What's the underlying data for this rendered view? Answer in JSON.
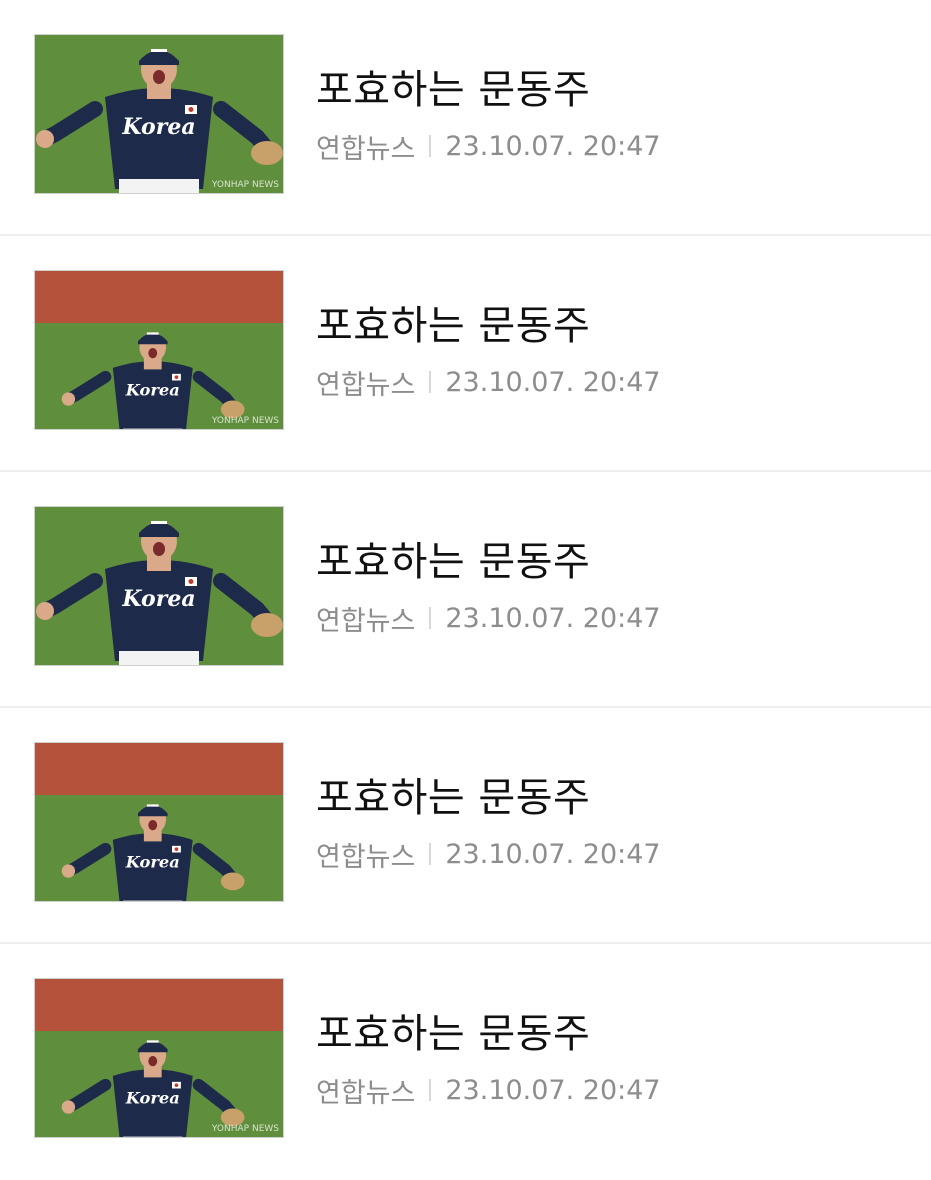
{
  "news_list": {
    "items": [
      {
        "thumbnail_alt": "",
        "title": "포효하는 문동주",
        "source": "연합뉴스",
        "datetime": "23.10.07. 20:47",
        "watermark": "YONHAP NEWS",
        "jersey_text": "Korea",
        "photo_variant": "closeup"
      },
      {
        "thumbnail_alt": "",
        "title": "포효하는 문동주",
        "source": "연합뉴스",
        "datetime": "23.10.07. 20:47",
        "watermark": "YONHAP NEWS",
        "jersey_text": "Korea",
        "photo_variant": "wide"
      },
      {
        "thumbnail_alt": "",
        "title": "포효하는 문동주",
        "source": "연합뉴스",
        "datetime": "23.10.07. 20:47",
        "watermark": "",
        "jersey_text": "Korea",
        "photo_variant": "closeup"
      },
      {
        "thumbnail_alt": "",
        "title": "포효하는 문동주",
        "source": "연합뉴스",
        "datetime": "23.10.07. 20:47",
        "watermark": "",
        "jersey_text": "Korea",
        "photo_variant": "wide"
      },
      {
        "thumbnail_alt": "",
        "title": "포효하는 문동주",
        "source": "연합뉴스",
        "datetime": "23.10.07. 20:47",
        "watermark": "YONHAP NEWS",
        "jersey_text": "Korea",
        "photo_variant": "wide"
      }
    ]
  },
  "colors": {
    "title": "#111111",
    "meta": "#8d8d8d",
    "divider": "#efefef",
    "grass": "#5f8f3c",
    "warning_track": "#b5523c",
    "jersey": "#1e2a4a"
  }
}
